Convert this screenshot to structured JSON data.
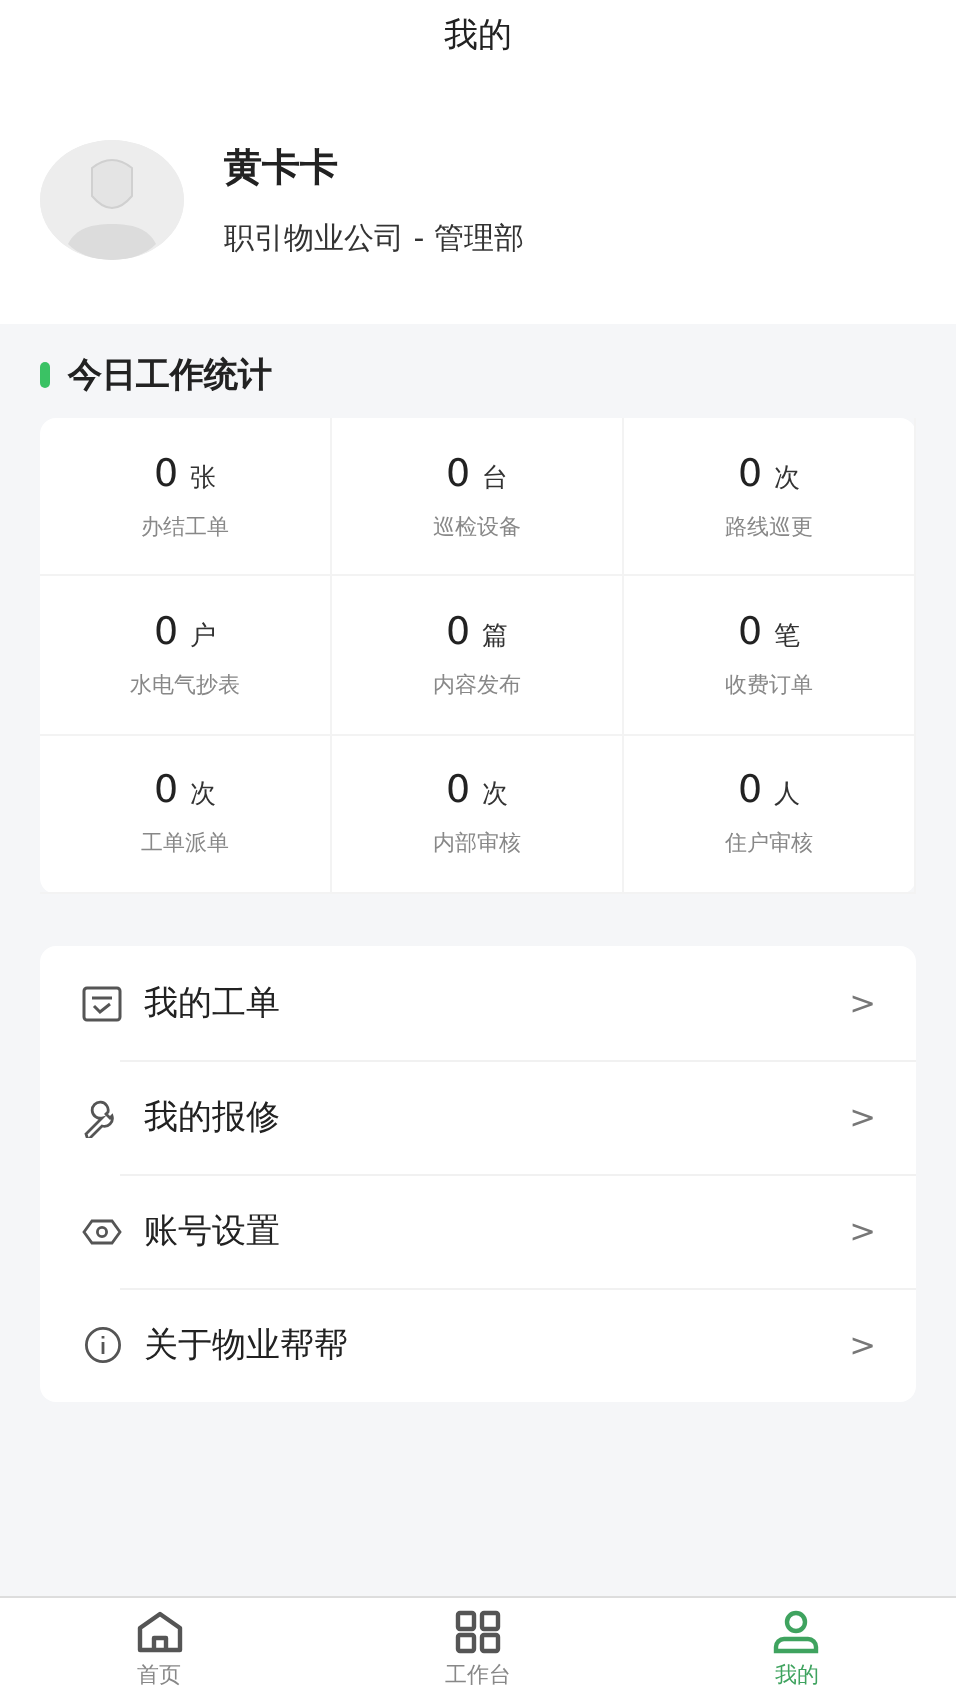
{
  "title": "我的",
  "profile": {
    "name": "黄卡卡",
    "org": "职引物业公司 - 管理部"
  },
  "section_title": "今日工作统计",
  "stats": [
    {
      "value": "0",
      "unit": "张",
      "label": "办结工单"
    },
    {
      "value": "0",
      "unit": "台",
      "label": "巡检设备"
    },
    {
      "value": "0",
      "unit": "次",
      "label": "路线巡更"
    },
    {
      "value": "0",
      "unit": "户",
      "label": "水电气抄表"
    },
    {
      "value": "0",
      "unit": "篇",
      "label": "内容发布"
    },
    {
      "value": "0",
      "unit": "笔",
      "label": "收费订单"
    },
    {
      "value": "0",
      "unit": "次",
      "label": "工单派单"
    },
    {
      "value": "0",
      "unit": "次",
      "label": "内部审核"
    },
    {
      "value": "0",
      "unit": "人",
      "label": "住户审核"
    }
  ],
  "menu": [
    {
      "label": "我的工单",
      "arrow": ">"
    },
    {
      "label": "我的报修",
      "arrow": ">"
    },
    {
      "label": "账号设置",
      "arrow": ">"
    },
    {
      "label": "关于物业帮帮",
      "arrow": ">"
    }
  ],
  "tabs": [
    {
      "label": "首页",
      "selected": false
    },
    {
      "label": "工作台",
      "selected": false
    },
    {
      "label": "我的",
      "selected": true
    }
  ]
}
